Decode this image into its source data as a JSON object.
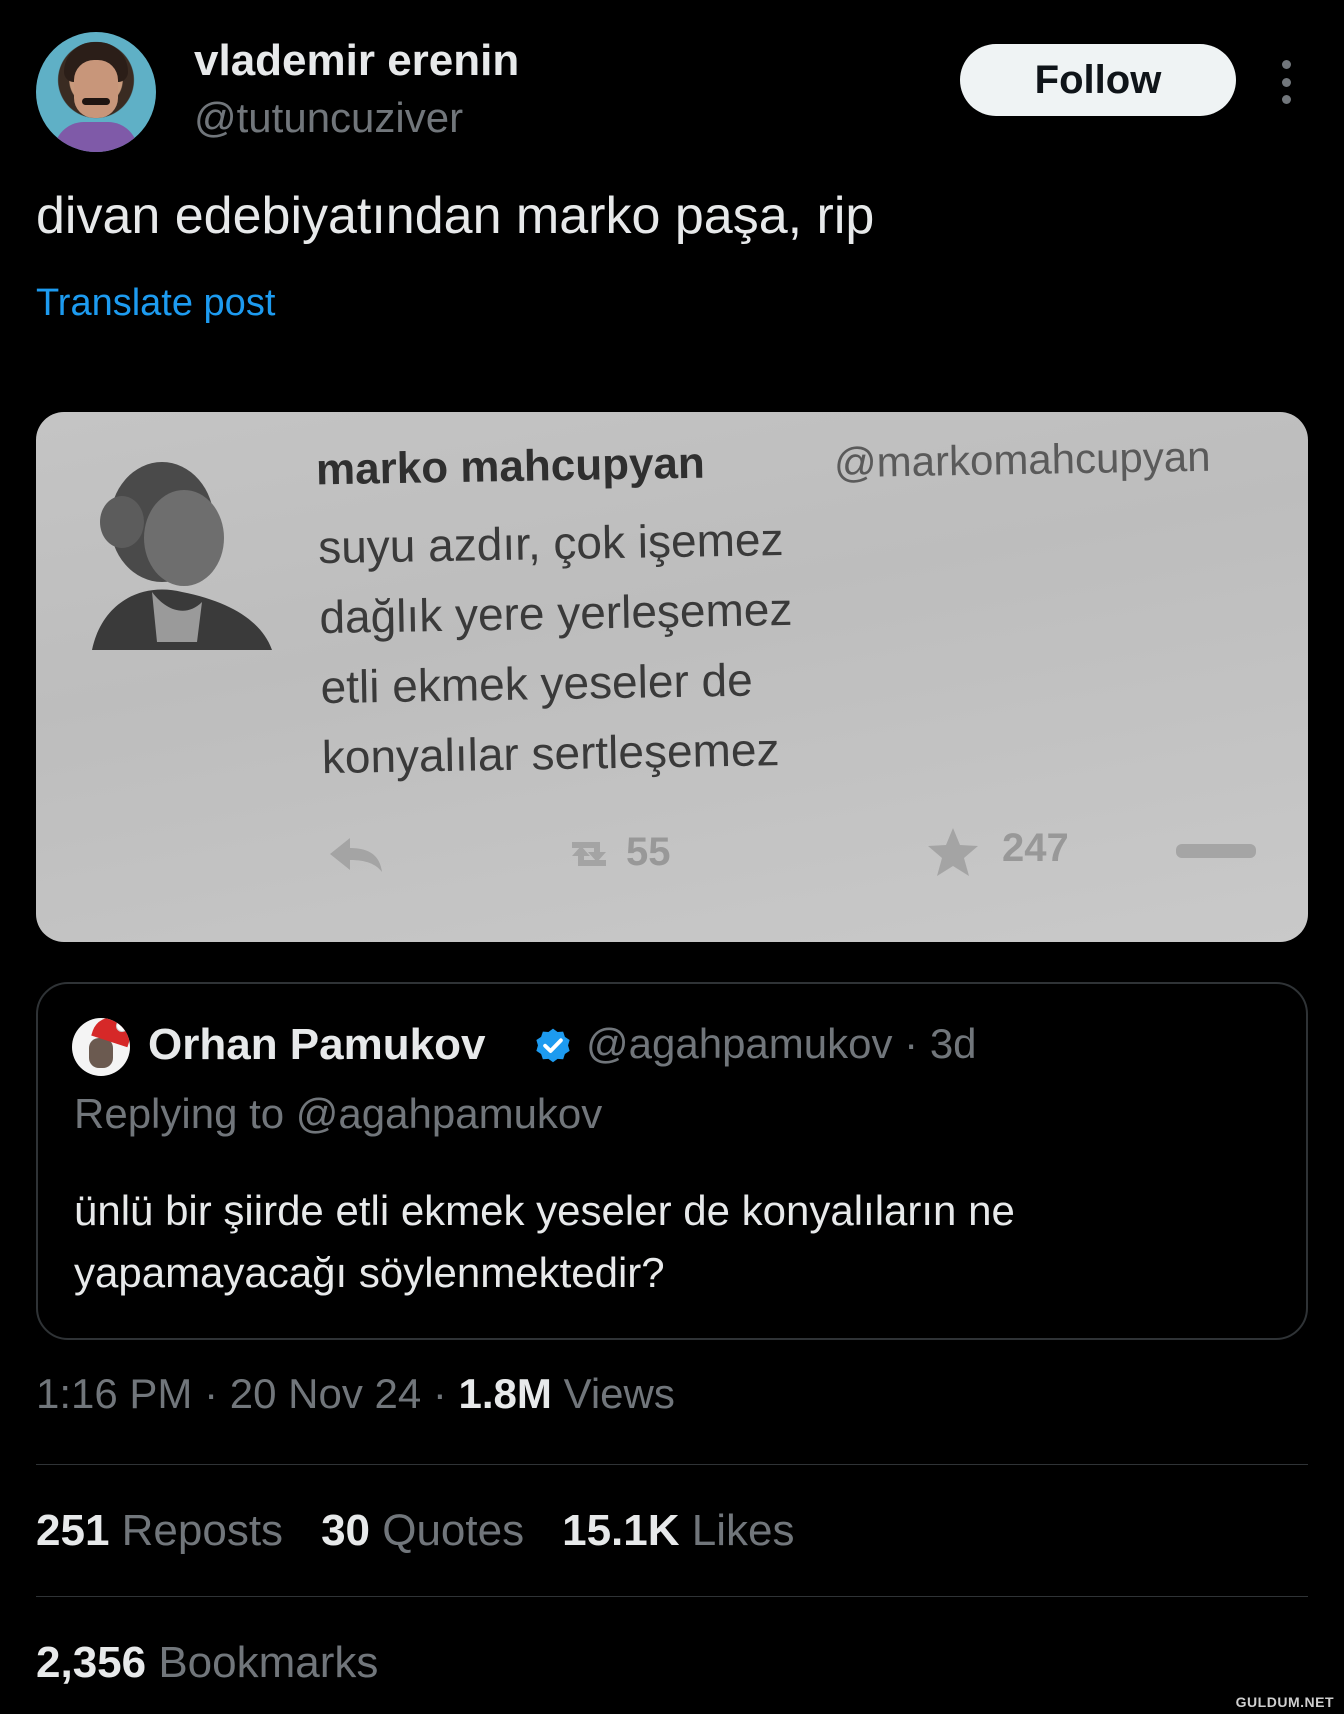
{
  "author": {
    "name": "vlademir erenin",
    "handle": "@tutuncuziver"
  },
  "follow_label": "Follow",
  "post_text": "divan edebiyatından marko paşa, rip",
  "translate_label": "Translate post",
  "media": {
    "name": "marko mahcupyan",
    "handle": "@markomahcupyan",
    "lines": [
      "suyu azdır, çok işemez",
      "dağlık yere yerleşemez",
      "etli ekmek yeseler de",
      "konyalılar sertleşemez"
    ],
    "retweets": "55",
    "favorites": "247"
  },
  "quote": {
    "name": "Orhan Pamukov",
    "meta": "@agahpamukov · 3d",
    "replying_to": "Replying to @agahpamukov",
    "text_lines": [
      "ünlü bir şiirde etli ekmek yeseler de konyalıların ne",
      "yapamayacağı söylenmektedir?"
    ]
  },
  "timestamp": {
    "time_date": "1:16 PM · 20 Nov 24 · ",
    "views_count": "1.8M",
    "views_label": " Views"
  },
  "stats": {
    "reposts_count": "251",
    "reposts_label": " Reposts",
    "quotes_count": "30",
    "quotes_label": " Quotes",
    "likes_count": "15.1K",
    "likes_label": " Likes",
    "bookmarks_count": "2,356",
    "bookmarks_label": " Bookmarks"
  },
  "watermark": "GULDUM.NET",
  "colors": {
    "background": "#000000",
    "link": "#1d9bf0",
    "muted": "#71767b",
    "text": "#e7e9ea"
  }
}
